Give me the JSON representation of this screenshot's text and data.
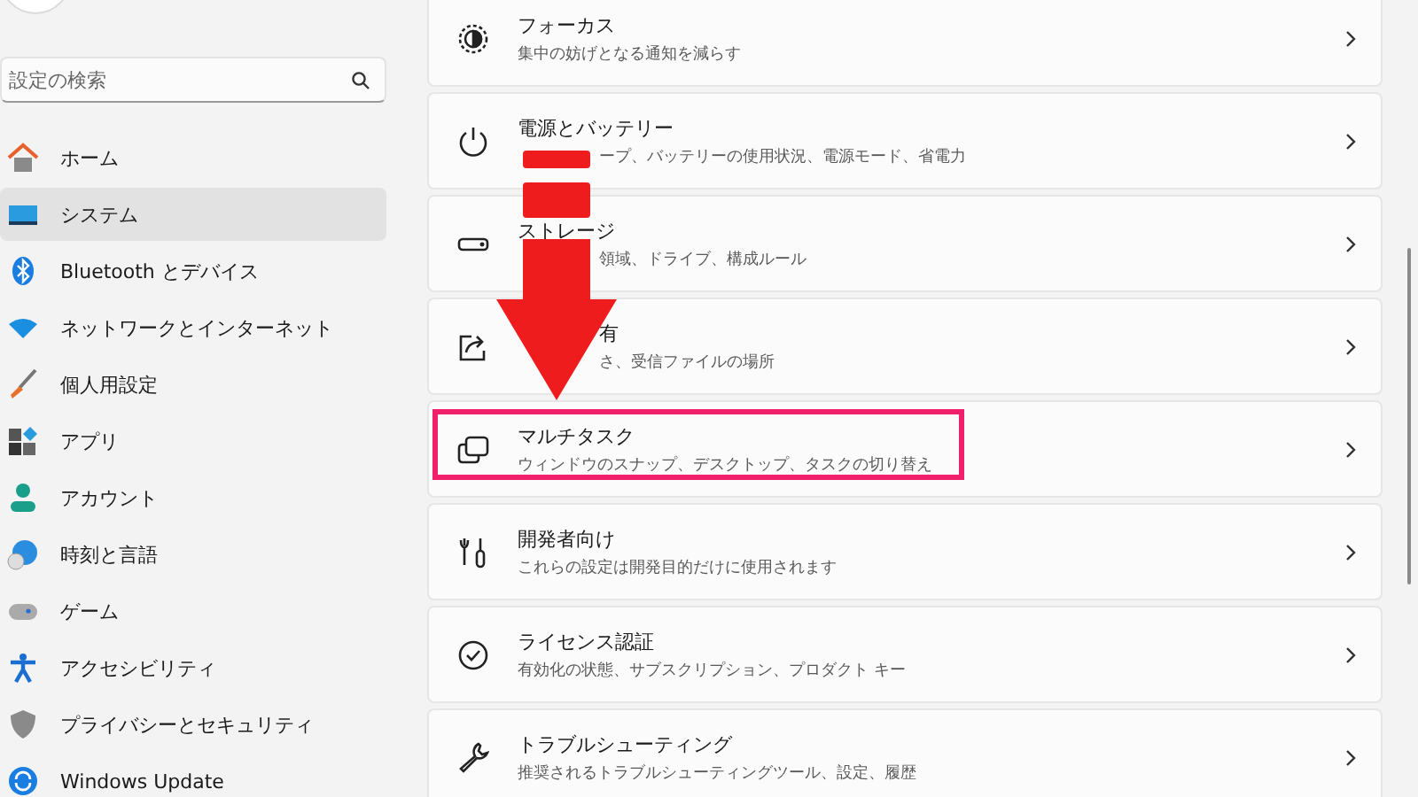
{
  "search": {
    "placeholder": "設定の検索"
  },
  "nav": [
    {
      "label": "ホーム",
      "selected": false
    },
    {
      "label": "システム",
      "selected": true
    },
    {
      "label": "Bluetooth とデバイス",
      "selected": false
    },
    {
      "label": "ネットワークとインターネット",
      "selected": false
    },
    {
      "label": "個人用設定",
      "selected": false
    },
    {
      "label": "アプリ",
      "selected": false
    },
    {
      "label": "アカウント",
      "selected": false
    },
    {
      "label": "時刻と言語",
      "selected": false
    },
    {
      "label": "ゲーム",
      "selected": false
    },
    {
      "label": "アクセシビリティ",
      "selected": false
    },
    {
      "label": "プライバシーとセキュリティ",
      "selected": false
    },
    {
      "label": "Windows Update",
      "selected": false
    }
  ],
  "cards": [
    {
      "title": "フォーカス",
      "subtitle": "集中の妨げとなる通知を減らす",
      "highlighted": false
    },
    {
      "title": "電源とバッテリー",
      "subtitle": "ープ、バッテリーの使用状況、電源モード、省電力",
      "highlighted": false
    },
    {
      "title": "ストレージ",
      "subtitle": "領域、ドライブ、構成ルール",
      "highlighted": false
    },
    {
      "title": "有",
      "subtitle": "さ、受信ファイルの場所",
      "highlighted": false
    },
    {
      "title": "マルチタスク",
      "subtitle": "ウィンドウのスナップ、デスクトップ、タスクの切り替え",
      "highlighted": true
    },
    {
      "title": "開発者向け",
      "subtitle": "これらの設定は開発目的だけに使用されます",
      "highlighted": false
    },
    {
      "title": "ライセンス認証",
      "subtitle": "有効化の状態、サブスクリプション、プロダクト キー",
      "highlighted": false
    },
    {
      "title": "トラブルシューティング",
      "subtitle": "推奨されるトラブルシューティングツール、設定、履歴",
      "highlighted": false
    }
  ]
}
